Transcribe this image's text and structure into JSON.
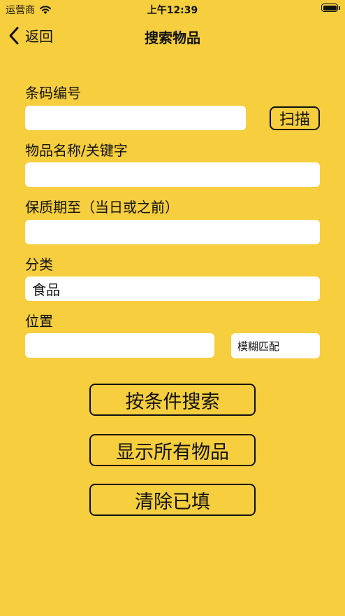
{
  "status_bar": {
    "carrier": "运营商",
    "time": "上午12:39"
  },
  "nav": {
    "back_label": "返回",
    "title": "搜索物品"
  },
  "form": {
    "barcode": {
      "label": "条码编号",
      "value": "",
      "scan_label": "扫描"
    },
    "name": {
      "label": "物品名称/关键字",
      "value": ""
    },
    "expiry": {
      "label": "保质期至（当日或之前）",
      "value": ""
    },
    "category": {
      "label": "分类",
      "value": "食品"
    },
    "location": {
      "label": "位置",
      "value": "",
      "match_mode": "模糊匹配"
    }
  },
  "actions": {
    "search_label": "按条件搜索",
    "show_all_label": "显示所有物品",
    "clear_label": "清除已填"
  },
  "colors": {
    "background": "#f6ce3e",
    "field": "#ffffff",
    "text": "#111111"
  }
}
